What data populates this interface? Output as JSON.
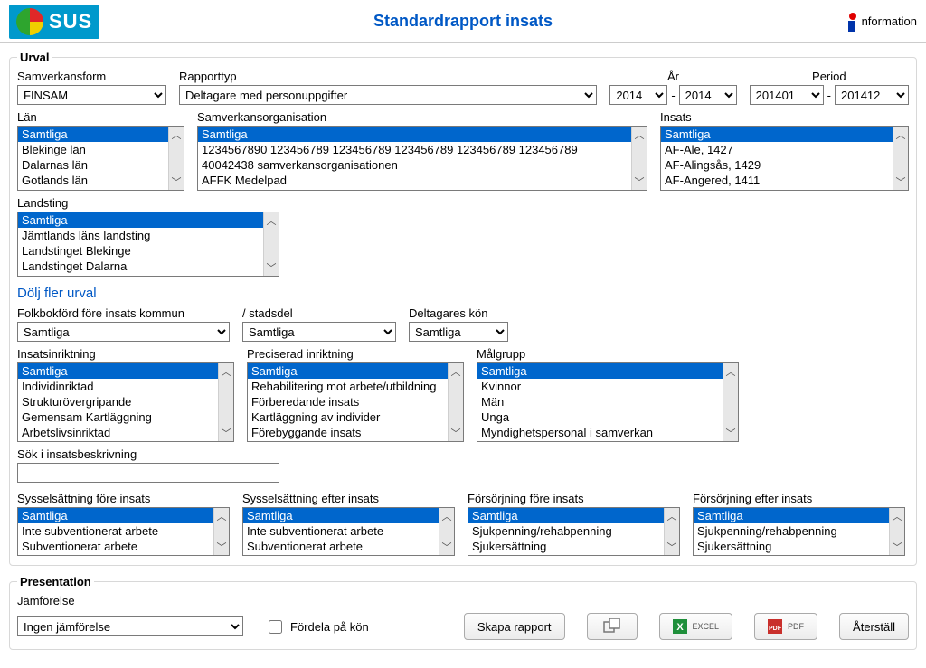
{
  "header": {
    "logo_text": "SUS",
    "page_title": "Standardrapport insats",
    "info_label": "nformation"
  },
  "urval": {
    "legend": "Urval",
    "samverkansform": {
      "label": "Samverkansform",
      "value": "FINSAM"
    },
    "rapporttyp": {
      "label": "Rapporttyp",
      "value": "Deltagare med personuppgifter"
    },
    "ar": {
      "label": "År",
      "from": "2014",
      "to": "2014"
    },
    "period": {
      "label": "Period",
      "from": "201401",
      "to": "201412"
    },
    "lan": {
      "label": "Län",
      "items": [
        "Samtliga",
        "Blekinge län",
        "Dalarnas län",
        "Gotlands län"
      ],
      "selected": "Samtliga"
    },
    "samverkansorganisation": {
      "label": "Samverkansorganisation",
      "items": [
        "Samtliga",
        "1234567890 123456789 123456789 123456789 123456789 123456789",
        "40042438 samverkansorganisationen",
        "AFFK Medelpad"
      ],
      "selected": "Samtliga"
    },
    "insats": {
      "label": "Insats",
      "items": [
        "Samtliga",
        "AF-Ale, 1427",
        "AF-Alingsås, 1429",
        "AF-Angered, 1411"
      ],
      "selected": "Samtliga"
    },
    "landsting": {
      "label": "Landsting",
      "items": [
        "Samtliga",
        "Jämtlands läns landsting",
        "Landstinget Blekinge",
        "Landstinget Dalarna"
      ],
      "selected": "Samtliga"
    },
    "toggle_link": "Dölj fler urval",
    "folkbokford": {
      "label": "Folkbokförd före insats kommun",
      "value": "Samtliga"
    },
    "stadsdel": {
      "label": "/ stadsdel",
      "value": "Samtliga"
    },
    "deltagares_kon": {
      "label": "Deltagares kön",
      "value": "Samtliga"
    },
    "insatsinriktning": {
      "label": "Insatsinriktning",
      "items": [
        "Samtliga",
        "Individinriktad",
        "Strukturövergripande",
        "Gemensam Kartläggning",
        "Arbetslivsinriktad"
      ],
      "selected": "Samtliga"
    },
    "preciserad": {
      "label": "Preciserad inriktning",
      "items": [
        "Samtliga",
        "Rehabilitering mot arbete/utbildning",
        "Förberedande insats",
        "Kartläggning av individer",
        "Förebyggande insats"
      ],
      "selected": "Samtliga"
    },
    "malgrupp": {
      "label": "Målgrupp",
      "items": [
        "Samtliga",
        "Kvinnor",
        "Män",
        "Unga",
        "Myndighetspersonal i samverkan"
      ],
      "selected": "Samtliga"
    },
    "sok": {
      "label": "Sök i insatsbeskrivning",
      "value": ""
    },
    "syssel_fore": {
      "label": "Sysselsättning före insats",
      "items": [
        "Samtliga",
        "Inte subventionerat arbete",
        "Subventionerat arbete"
      ],
      "selected": "Samtliga"
    },
    "syssel_efter": {
      "label": "Sysselsättning efter insats",
      "items": [
        "Samtliga",
        "Inte subventionerat arbete",
        "Subventionerat arbete"
      ],
      "selected": "Samtliga"
    },
    "forsorj_fore": {
      "label": "Försörjning före insats",
      "items": [
        "Samtliga",
        "Sjukpenning/rehabpenning",
        "Sjukersättning"
      ],
      "selected": "Samtliga"
    },
    "forsorj_efter": {
      "label": "Försörjning efter insats",
      "items": [
        "Samtliga",
        "Sjukpenning/rehabpenning",
        "Sjukersättning"
      ],
      "selected": "Samtliga"
    }
  },
  "presentation": {
    "legend": "Presentation",
    "jamforelse": {
      "label": "Jämförelse",
      "value": "Ingen jämförelse"
    },
    "fordela": "Fördela på kön",
    "skapa": "Skapa rapport",
    "excel": "EXCEL",
    "pdf": "PDF",
    "aterstall": "Återställ"
  }
}
